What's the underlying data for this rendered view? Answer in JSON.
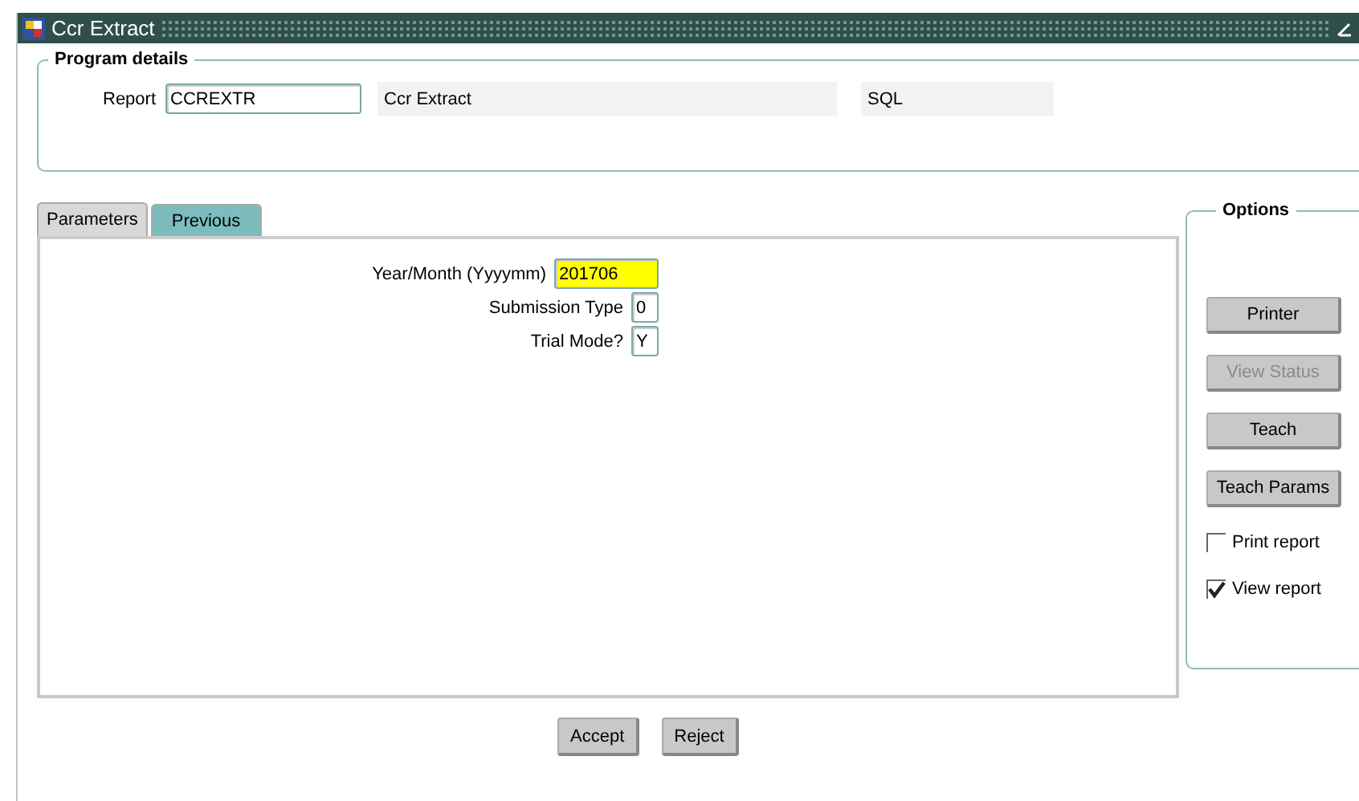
{
  "window": {
    "title": "Ccr Extract"
  },
  "program_details": {
    "title": "Program details",
    "label": "Report",
    "code": "CCREXTR",
    "name": "Ccr Extract",
    "type": "SQL"
  },
  "tabs": [
    {
      "label": "Parameters",
      "selected": true
    },
    {
      "label": "Previous",
      "selected": false
    }
  ],
  "parameters": [
    {
      "label": "Year/Month (Yyyymm)",
      "value": "201706",
      "focused": true
    },
    {
      "label": "Submission Type",
      "value": "0",
      "focused": false
    },
    {
      "label": "Trial Mode?",
      "value": "Y",
      "focused": false
    }
  ],
  "options": {
    "title": "Options",
    "buttons": [
      {
        "label": "Printer",
        "disabled": false
      },
      {
        "label": "View Status",
        "disabled": true
      },
      {
        "label": "Teach",
        "disabled": false
      },
      {
        "label": "Teach Params",
        "disabled": false
      }
    ],
    "checkboxes": [
      {
        "label": "Print report",
        "checked": false
      },
      {
        "label": "View report",
        "checked": true
      }
    ]
  },
  "actions": [
    "Accept",
    "Reject"
  ]
}
